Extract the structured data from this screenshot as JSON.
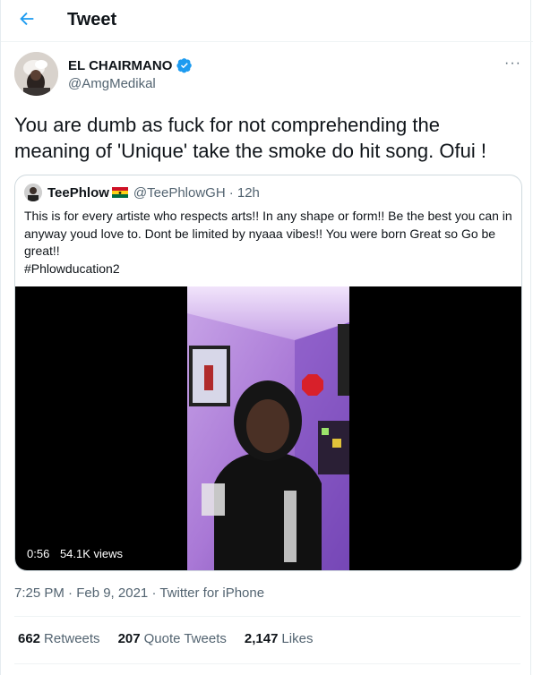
{
  "header": {
    "title": "Tweet",
    "back_icon": "arrow-left-icon",
    "accent": "#1d9bf0"
  },
  "tweet": {
    "author": {
      "name": "EL CHAIRMANO",
      "handle": "@AmgMedikal",
      "verified": true
    },
    "more_icon": "more-horizontal-icon",
    "more_label": "···",
    "text": "You are dumb as fuck for not comprehending the meaning of 'Unique' take the smoke do hit song. Ofui !",
    "timestamp": "7:25 PM · Feb 9, 2021",
    "source": "Twitter for iPhone"
  },
  "quoted": {
    "author": {
      "name": "TeePhlow",
      "handle": "@TeePhlowGH",
      "time": "· 12h",
      "flag_icon": "ghana-flag-icon"
    },
    "text": "This is for every artiste who respects arts!! In any shape or form!! Be the best you can in anyway youd love to. Dont be limited by nyaaa vibes!! You were born Great so Go be great!!\n#Phlowducation2",
    "video": {
      "duration": "0:56",
      "views": "54.1K views"
    }
  },
  "stats": {
    "retweets_count": "662",
    "retweets_label": "Retweets",
    "quotes_count": "207",
    "quotes_label": "Quote Tweets",
    "likes_count": "2,147",
    "likes_label": "Likes"
  }
}
